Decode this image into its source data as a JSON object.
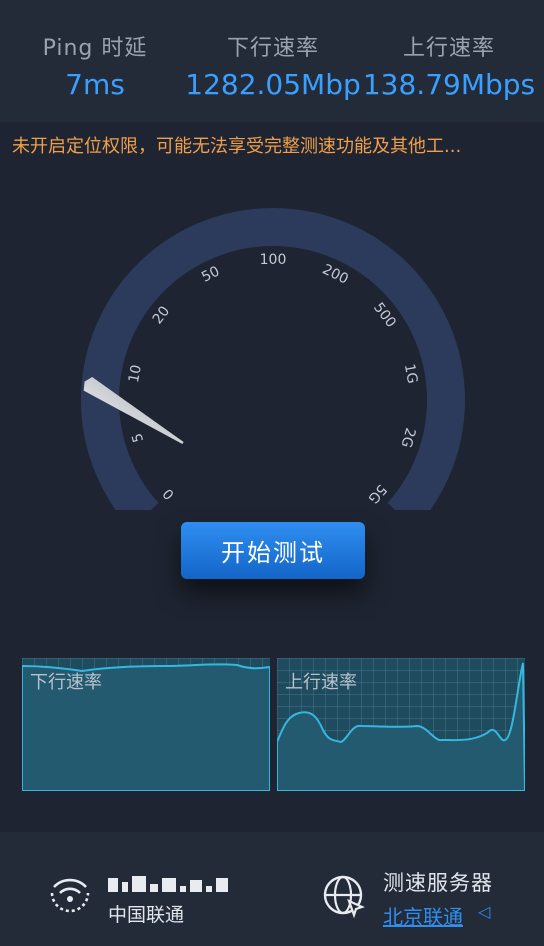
{
  "stats": {
    "ping_label": "Ping 时延",
    "ping_value": "7ms",
    "down_label": "下行速率",
    "down_value": "1282.05Mbp",
    "up_label": "上行速率",
    "up_value": "138.79Mbps"
  },
  "warning": "未开启定位权限，可能无法享受完整测速功能及其他工...",
  "gauge": {
    "ticks": [
      "0",
      "5",
      "10",
      "20",
      "50",
      "100",
      "200",
      "500",
      "1G",
      "2G",
      "5G"
    ],
    "needle_fraction": 0.28
  },
  "start_button": "开始测试",
  "graphs": {
    "down_label": "下行速率",
    "up_label": "上行速率",
    "color": "#35b8e0"
  },
  "footer": {
    "isp_name": "中国联通",
    "server_title": "测速服务器",
    "server_name": "北京联通",
    "server_caret": "◁"
  },
  "colors": {
    "accent": "#3aa0ff",
    "warning": "#f0a04b",
    "gauge_track": "#2c3a5c"
  }
}
